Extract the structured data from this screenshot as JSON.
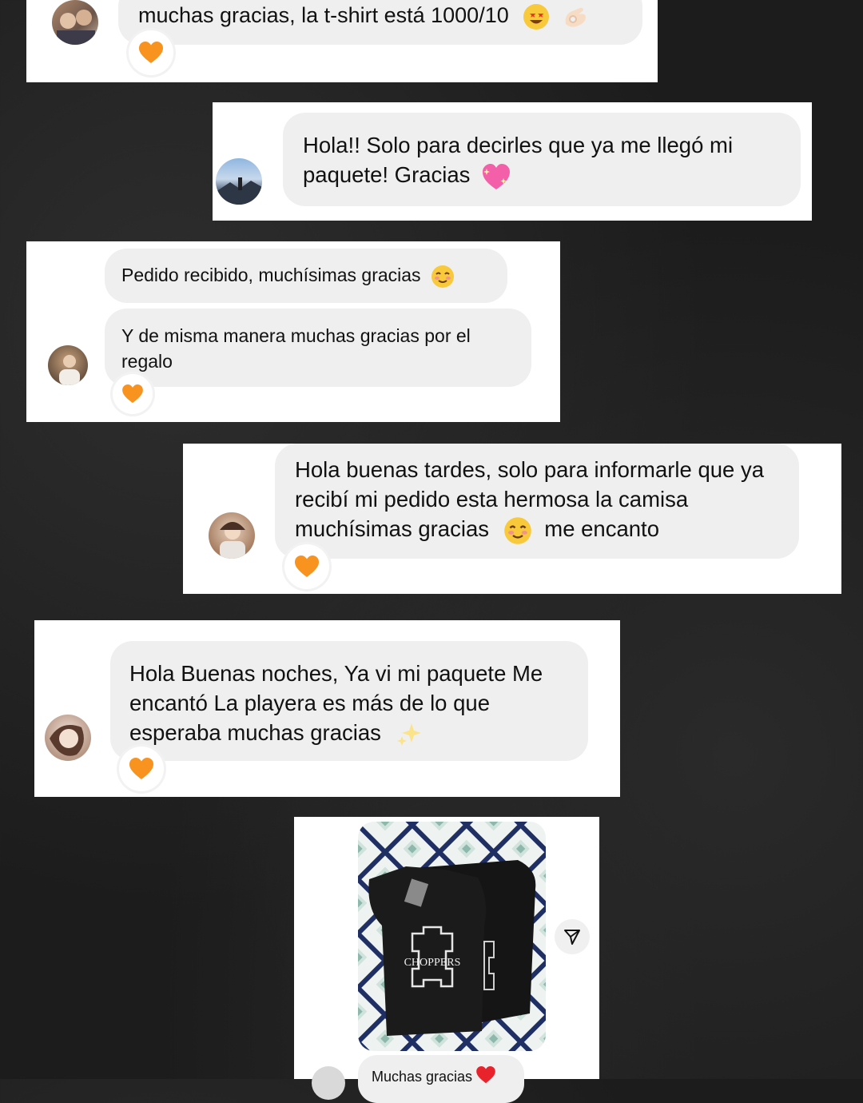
{
  "messages": [
    {
      "text": "muchas gracias, la t-shirt está 1000/10",
      "emojis": [
        "star-struck-emoji",
        "ok-hand-emoji"
      ],
      "reaction": "orange-heart"
    },
    {
      "text": "Hola!! Solo para decirles que ya me llegó mi paquete! Gracias",
      "emojis": [
        "sparkling-heart-emoji"
      ]
    },
    {
      "text": "Pedido recibido, muchísimas gracias",
      "emojis": [
        "smiling-blush-emoji"
      ]
    },
    {
      "text": "Y de misma manera muchas gracias por el regalo",
      "reaction": "orange-heart"
    },
    {
      "text_a": "Hola buenas tardes, solo para informarle que ya recibí mi pedido esta hermosa la camisa muchísimas gracias",
      "text_b": "me encanto",
      "emojis": [
        "smiling-blush-emoji"
      ],
      "reaction": "orange-heart"
    },
    {
      "text": "Hola Buenas noches, Ya vi mi paquete Me encantó La playera es más de lo que esperaba muchas gracias",
      "emojis": [
        "sparkles-emoji"
      ],
      "reaction": "orange-heart"
    },
    {
      "photo_label": "CHOPPERS",
      "caption": "Muchas gracias",
      "emojis": [
        "red-heart-emoji"
      ],
      "action": "share-icon"
    }
  ],
  "colors": {
    "bubble": "#efefef",
    "card": "#ffffff",
    "reaction_heart": "#f7931e",
    "background": "#1c1c1c"
  }
}
